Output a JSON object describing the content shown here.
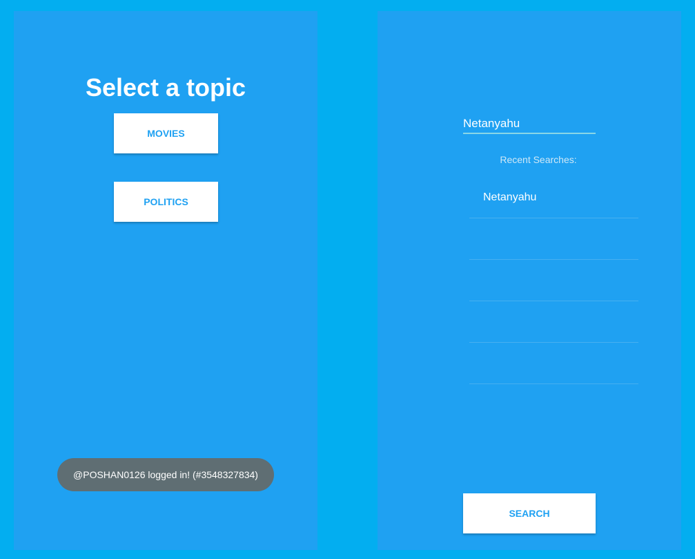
{
  "left_panel": {
    "title": "Select a topic",
    "topics": [
      {
        "label": "MOVIES"
      },
      {
        "label": "POLITICS"
      }
    ],
    "toast": "@POSHAN0126 logged in! (#3548327834)"
  },
  "right_panel": {
    "search": {
      "value": "Netanyahu"
    },
    "recent_label": "Recent Searches:",
    "recent_items": [
      {
        "label": "Netanyahu"
      },
      {
        "label": ""
      },
      {
        "label": ""
      },
      {
        "label": ""
      },
      {
        "label": ""
      }
    ],
    "search_button": "SEARCH"
  },
  "colors": {
    "background": "#03aef0",
    "panel": "#1fa1f2",
    "button_text": "#1fa1f2",
    "toast": "#5f6e73"
  }
}
